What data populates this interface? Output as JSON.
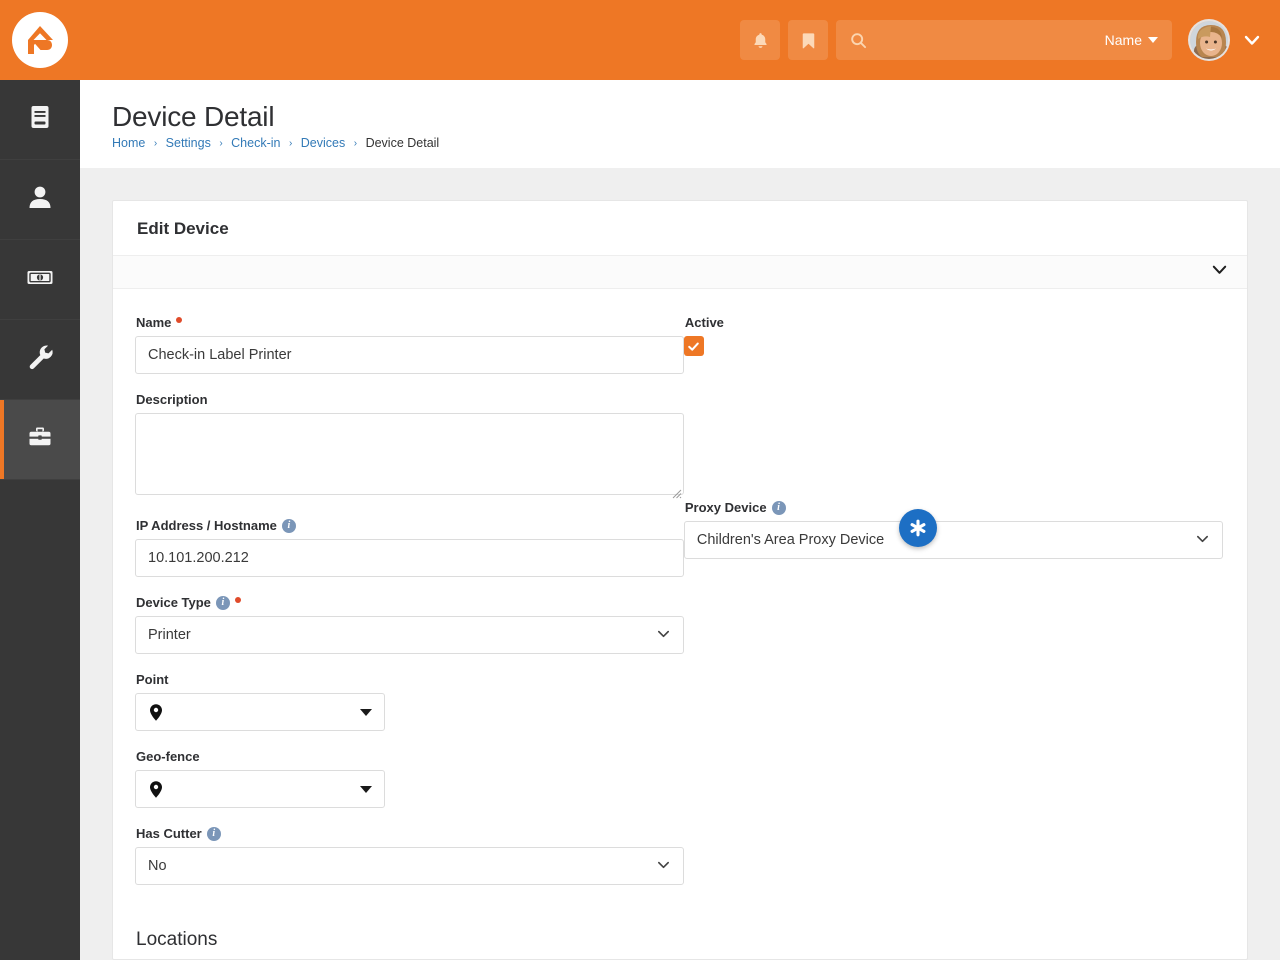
{
  "header": {
    "logo_alt": "Rock RMS logo",
    "notifications_icon": "bell-icon",
    "bookmarks_icon": "bookmark-icon",
    "search": {
      "icon": "search-icon",
      "value": "",
      "placeholder": "",
      "scope_label": "Name"
    },
    "user_menu": {
      "avatar_alt": "User avatar",
      "caret_icon": "chevron-down-icon"
    },
    "brand_color": "#ee7725"
  },
  "sidebar": {
    "background": "#373737",
    "active_background": "#4a4a4a",
    "active_marker_color": "#ee7725",
    "items": [
      {
        "icon": "book-icon",
        "label": "",
        "active": false
      },
      {
        "icon": "person-icon",
        "label": "",
        "active": false
      },
      {
        "icon": "money-bill-icon",
        "label": "",
        "active": false
      },
      {
        "icon": "wrench-icon",
        "label": "",
        "active": false
      },
      {
        "icon": "toolbox-icon",
        "label": "",
        "active": true
      }
    ]
  },
  "page": {
    "title": "Device Detail",
    "breadcrumb": [
      {
        "label": "Home",
        "link": true
      },
      {
        "label": "Settings",
        "link": true
      },
      {
        "label": "Check-in",
        "link": true
      },
      {
        "label": "Devices",
        "link": true
      },
      {
        "label": "Device Detail",
        "link": false
      }
    ],
    "breadcrumb_separator": "›",
    "link_color": "#337ab7"
  },
  "panel": {
    "title": "Edit Device",
    "collapse_icon": "chevron-down-icon",
    "fields": {
      "name": {
        "label": "Name",
        "required": true,
        "value": "Check-in Label Printer",
        "placeholder": ""
      },
      "active": {
        "label": "Active",
        "checked": true,
        "check_glyph": "✔",
        "color": "#ee7725"
      },
      "description": {
        "label": "Description",
        "value": "",
        "placeholder": ""
      },
      "ip_address": {
        "label": "IP Address / Hostname",
        "info_icon": "info-icon",
        "value": "10.101.200.212",
        "placeholder": ""
      },
      "proxy_device": {
        "label": "Proxy Device",
        "info_icon": "info-icon",
        "value": "Children's Area Proxy Device",
        "caret_icon": "chevron-down-icon",
        "badge": {
          "icon": "sparkle-asterisk-icon",
          "glyph": "✱",
          "color": "#1d6fc4"
        }
      },
      "device_type": {
        "label": "Device Type",
        "info_icon": "info-icon",
        "required": true,
        "value": "Printer",
        "caret_icon": "chevron-down-icon"
      },
      "point": {
        "label": "Point",
        "value": "",
        "pin_icon": "map-pin-icon",
        "caret_icon": "caret-down-icon"
      },
      "geofence": {
        "label": "Geo-fence",
        "value": "",
        "pin_icon": "map-pin-icon",
        "caret_icon": "caret-down-icon"
      },
      "has_cutter": {
        "label": "Has Cutter",
        "info_icon": "info-icon",
        "value": "No",
        "caret_icon": "chevron-down-icon"
      }
    },
    "locations_heading": "Locations"
  }
}
